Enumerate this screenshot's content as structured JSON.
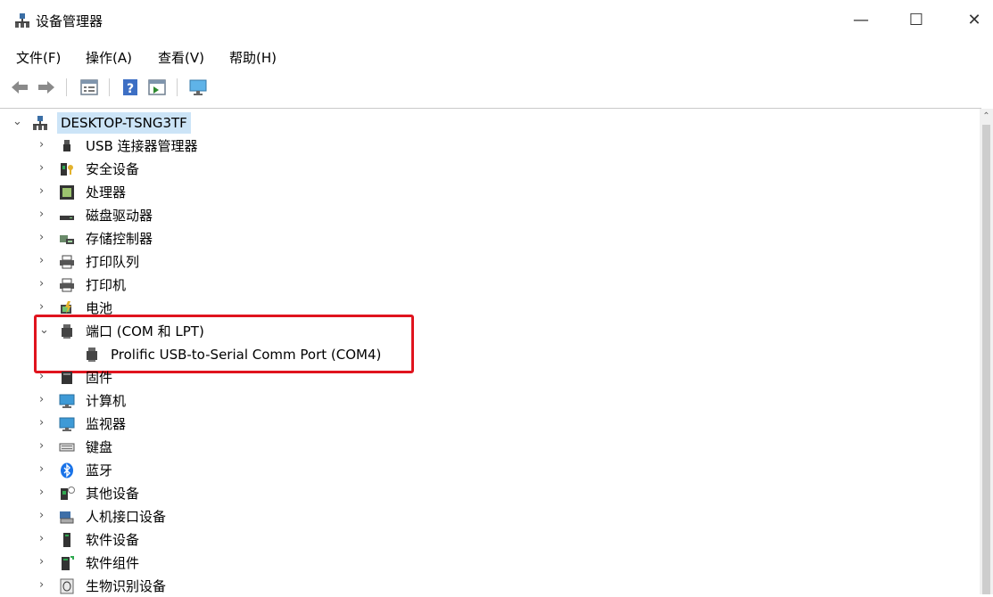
{
  "window": {
    "title": "设备管理器",
    "controls": {
      "minimize": "—",
      "maximize": "☐",
      "close": "✕"
    }
  },
  "menu": [
    "文件(F)",
    "操作(A)",
    "查看(V)",
    "帮助(H)"
  ],
  "toolbar": {
    "buttons": [
      "back-icon",
      "forward-icon",
      "properties-icon",
      "help-icon",
      "driver-icon",
      "monitor-icon"
    ]
  },
  "tree": {
    "root": "DESKTOP-TSNG3TF",
    "items": [
      {
        "label": "USB 连接器管理器",
        "icon": "usb-icon"
      },
      {
        "label": "安全设备",
        "icon": "security-icon"
      },
      {
        "label": "处理器",
        "icon": "processor-icon"
      },
      {
        "label": "磁盘驱动器",
        "icon": "disk-icon"
      },
      {
        "label": "存储控制器",
        "icon": "storage-icon"
      },
      {
        "label": "打印队列",
        "icon": "printer-icon"
      },
      {
        "label": "打印机",
        "icon": "printer-icon"
      },
      {
        "label": "电池",
        "icon": "battery-icon"
      },
      {
        "label": "端口 (COM 和 LPT)",
        "icon": "port-icon",
        "expanded": true,
        "children": [
          {
            "label": "Prolific USB-to-Serial Comm Port (COM4)",
            "icon": "port-icon"
          }
        ]
      },
      {
        "label": "固件",
        "icon": "firmware-icon"
      },
      {
        "label": "计算机",
        "icon": "computer-icon"
      },
      {
        "label": "监视器",
        "icon": "monitor-icon"
      },
      {
        "label": "键盘",
        "icon": "keyboard-icon"
      },
      {
        "label": "蓝牙",
        "icon": "bluetooth-icon"
      },
      {
        "label": "其他设备",
        "icon": "other-device-icon"
      },
      {
        "label": "人机接口设备",
        "icon": "hid-icon"
      },
      {
        "label": "软件设备",
        "icon": "software-device-icon"
      },
      {
        "label": "软件组件",
        "icon": "software-component-icon"
      },
      {
        "label": "生物识别设备",
        "icon": "biometric-icon"
      }
    ]
  },
  "colors": {
    "selection": "#cce4f7",
    "highlight_border": "#e0141e",
    "accent": "#1a73e8"
  }
}
